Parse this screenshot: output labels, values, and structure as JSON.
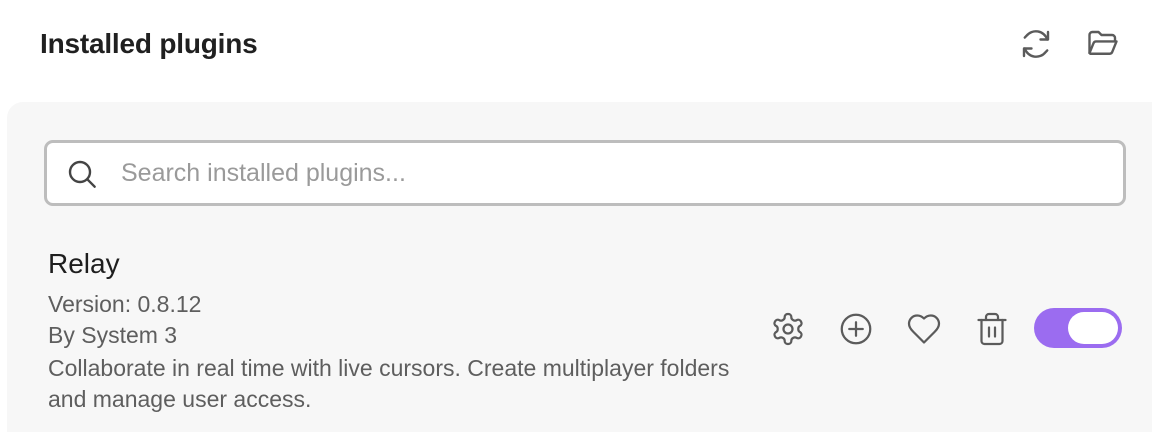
{
  "header": {
    "title": "Installed plugins",
    "reload_icon": "reload-icon",
    "folder_icon": "open-folder-icon"
  },
  "search": {
    "placeholder": "Search installed plugins...",
    "value": "",
    "icon": "search-icon"
  },
  "plugin": {
    "name": "Relay",
    "version": "Version: 0.8.12",
    "author": "By System 3",
    "description": "Collaborate in real time with live cursors. Create multiplayer folders and manage user access.",
    "actions": {
      "settings_icon": "gear-icon",
      "add_icon": "plus-circle-icon",
      "heart_icon": "heart-icon",
      "delete_icon": "trash-icon"
    },
    "enabled": true
  },
  "colors": {
    "accent": "#9b6cf0",
    "icon": "#5b5b5b",
    "panel_background": "#f7f7f7",
    "search_border": "#bdbdbd"
  }
}
